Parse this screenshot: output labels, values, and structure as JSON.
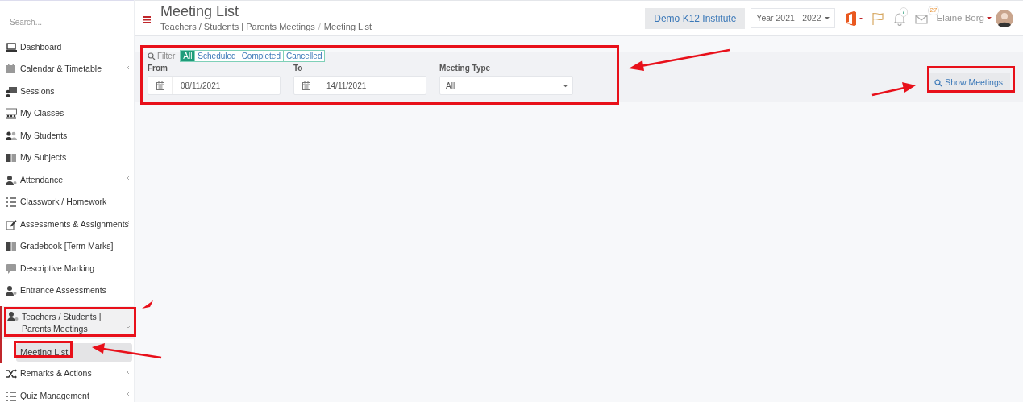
{
  "sidebar": {
    "search": {
      "placeholder": "Search..."
    },
    "items": [
      {
        "label": "Dashboard",
        "submenu": false,
        "expanded": false
      },
      {
        "label": "Calendar & Timetable",
        "submenu": true,
        "expanded": false
      },
      {
        "label": "Sessions",
        "submenu": false,
        "expanded": false
      },
      {
        "label": "My Classes",
        "submenu": false,
        "expanded": false
      },
      {
        "label": "My Students",
        "submenu": false,
        "expanded": false
      },
      {
        "label": "My Subjects",
        "submenu": false,
        "expanded": false
      },
      {
        "label": "Attendance",
        "submenu": true,
        "expanded": false
      },
      {
        "label": "Classwork / Homework",
        "submenu": false,
        "expanded": false
      },
      {
        "label": "Assessments & Assignments",
        "submenu": true,
        "expanded": false
      },
      {
        "label": "Gradebook [Term Marks]",
        "submenu": false,
        "expanded": false
      },
      {
        "label": "Descriptive Marking",
        "submenu": false,
        "expanded": false
      },
      {
        "label": "Entrance Assessments",
        "submenu": false,
        "expanded": false
      },
      {
        "label": "Teachers / Students | Parents Meetings",
        "submenu": true,
        "expanded": true,
        "children": [
          {
            "label": "Meeting List",
            "selected": true
          }
        ]
      },
      {
        "label": "Remarks & Actions",
        "submenu": true,
        "expanded": false
      },
      {
        "label": "Quiz Management",
        "submenu": true,
        "expanded": false
      }
    ]
  },
  "header": {
    "title": "Meeting List",
    "breadcrumb": [
      "Teachers / Students | Parents Meetings",
      "Meeting List"
    ],
    "breadcrumb_separator": "/",
    "institute": "Demo K12 Institute",
    "year": "Year 2021 - 2022",
    "notifications": "7",
    "messages": "27",
    "user": "Elaine Borg"
  },
  "filter": {
    "label": "Filter",
    "statuses": [
      {
        "label": "All",
        "selected": true
      },
      {
        "label": "Scheduled",
        "selected": false
      },
      {
        "label": "Completed",
        "selected": false
      },
      {
        "label": "Cancelled",
        "selected": false
      }
    ],
    "from": {
      "label": "From",
      "value": "08/11/2021"
    },
    "to": {
      "label": "To",
      "value": "14/11/2021"
    },
    "meeting_type": {
      "label": "Meeting Type",
      "value": "All"
    },
    "button": "Show Meetings"
  }
}
